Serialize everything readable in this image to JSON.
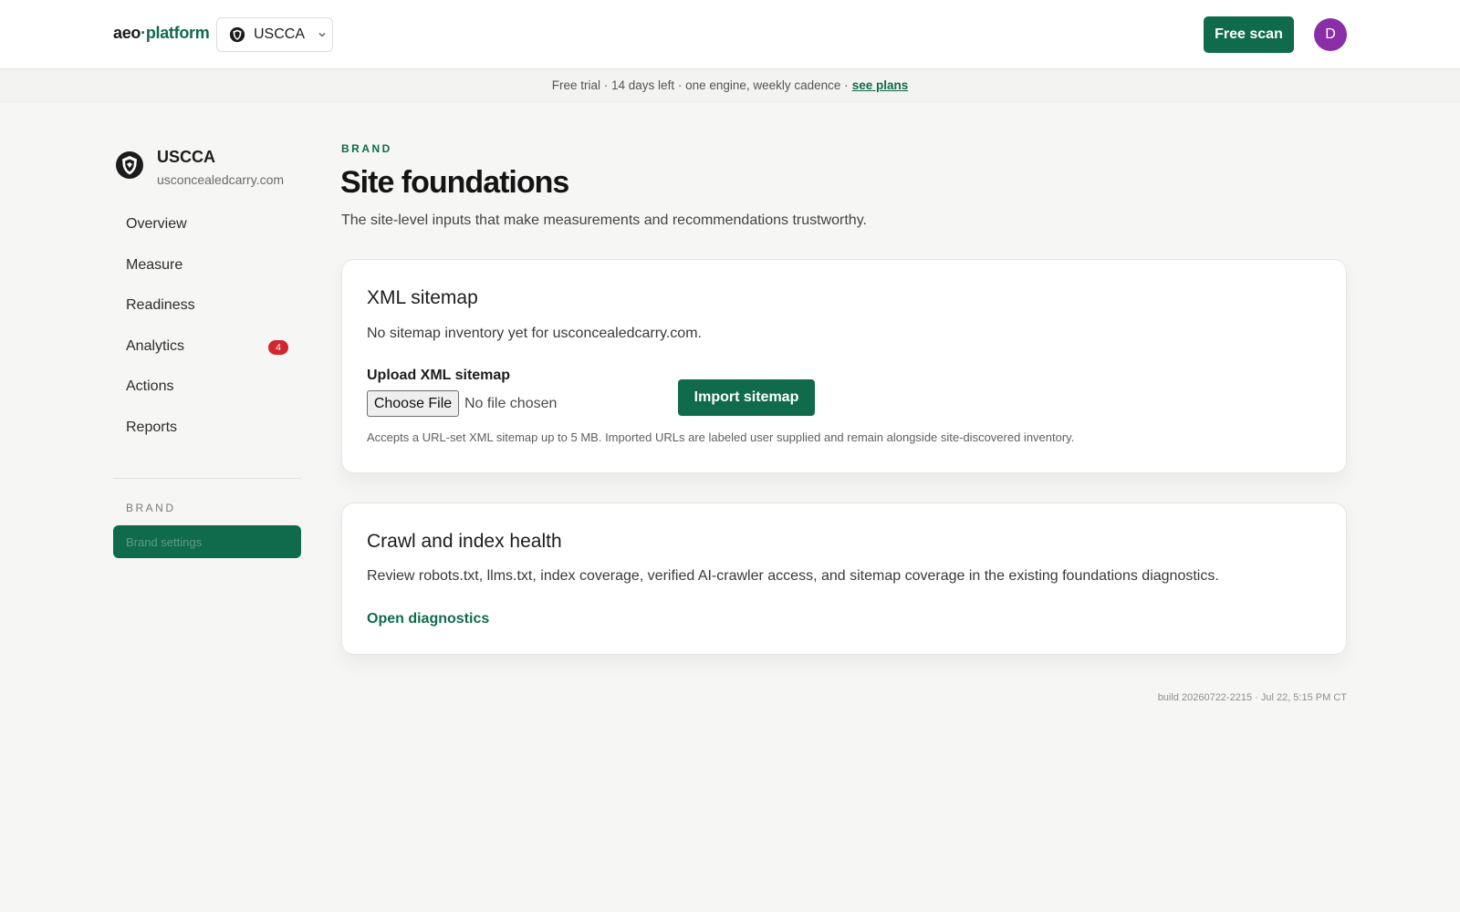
{
  "header": {
    "logo_left": "aeo",
    "logo_dot": "·",
    "logo_right": "platform",
    "brand_switch_label": "USCCA",
    "free_scan_label": "Free scan",
    "avatar_initial": "D",
    "colors": {
      "accent": "#0f6b4c",
      "avatar": "#8a2ea8"
    }
  },
  "trial": {
    "text": "Free trial · 14 days left · one engine, weekly cadence ·",
    "link": "see plans"
  },
  "sidebar": {
    "brand_name": "USCCA",
    "brand_domain": "usconcealedcarry.com",
    "items": [
      {
        "label": "Overview"
      },
      {
        "label": "Measure"
      },
      {
        "label": "Readiness"
      },
      {
        "label": "Analytics",
        "badge": "4"
      },
      {
        "label": "Actions"
      },
      {
        "label": "Reports"
      }
    ],
    "section_label": "BRAND",
    "settings_label": "Brand settings"
  },
  "main": {
    "eyebrow": "BRAND",
    "title": "Site foundations",
    "subtitle": "The site-level inputs that make measurements and recommendations trustworthy.",
    "sitemap_card": {
      "title": "XML sitemap",
      "desc": "No sitemap inventory yet for usconcealedcarry.com.",
      "upload_label": "Upload XML sitemap",
      "choose_file": "Choose File",
      "no_file": "No file chosen",
      "import_label": "Import sitemap",
      "hint": "Accepts a URL-set XML sitemap up to 5 MB. Imported URLs are labeled user supplied and remain alongside site-discovered inventory."
    },
    "crawl_card": {
      "title": "Crawl and index health",
      "desc": "Review robots.txt, llms.txt, index coverage, verified AI-crawler access, and sitemap coverage in the existing foundations diagnostics.",
      "link": "Open diagnostics"
    },
    "build": "build 20260722-2215 · Jul 22, 5:15 PM CT"
  }
}
